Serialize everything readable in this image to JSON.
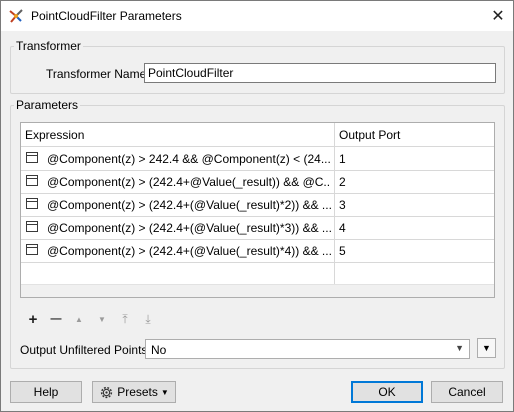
{
  "window": {
    "title": "PointCloudFilter Parameters",
    "close_glyph": "✕",
    "icon": "fme-transformer-icon"
  },
  "transformer_group": {
    "legend": "Transformer",
    "name_label": "Transformer Name:",
    "name_value": "PointCloudFilter"
  },
  "parameters_group": {
    "legend": "Parameters",
    "table": {
      "columns": [
        "Expression",
        "Output Port"
      ],
      "rows": [
        {
          "expression": "@Component(z) > 242.4 && @Component(z) < (24...",
          "port": "1"
        },
        {
          "expression": "@Component(z) > (242.4+@Value(_result)) && @C...",
          "port": "2"
        },
        {
          "expression": "@Component(z) > (242.4+(@Value(_result)*2)) && ...",
          "port": "3"
        },
        {
          "expression": "@Component(z) > (242.4+(@Value(_result)*3)) && ...",
          "port": "4"
        },
        {
          "expression": "@Component(z) > (242.4+(@Value(_result)*4)) && ...",
          "port": "5"
        }
      ]
    },
    "toolbar": {
      "add": "+",
      "remove": "—",
      "move_up": "▲",
      "move_down": "▼",
      "move_top": "⤒",
      "move_bottom": "⤓"
    },
    "unfiltered_label": "Output Unfiltered Points:",
    "unfiltered_value": "No"
  },
  "buttons": {
    "help": "Help",
    "presets": "Presets",
    "ok": "OK",
    "cancel": "Cancel"
  }
}
